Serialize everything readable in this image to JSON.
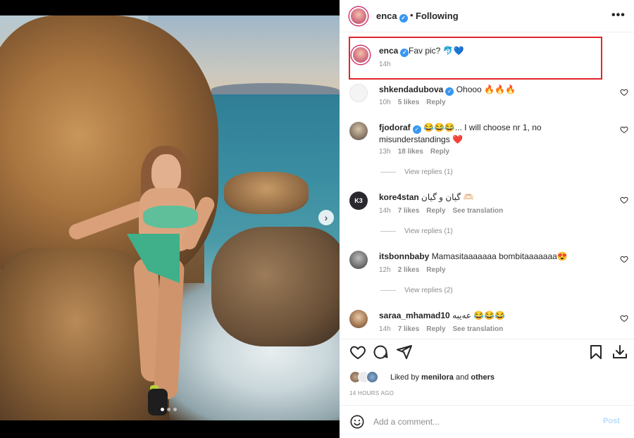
{
  "post": {
    "dots_count": 3,
    "active_dot": 0
  },
  "header": {
    "username": "enca",
    "verified_mark": "✓",
    "separator": "•",
    "follow_label": "Following",
    "more_label": "•••"
  },
  "caption": {
    "username": "enca",
    "text": "Fav pic? 🐬💙",
    "time": "14h"
  },
  "comments": [
    {
      "username": "shkendadubova",
      "verified": true,
      "text": "Ohooo 🔥🔥🔥",
      "time": "10h",
      "likes": "5 likes",
      "reply": "Reply",
      "translation": "",
      "view_replies": ""
    },
    {
      "username": "fjodoraf",
      "verified": true,
      "text": "😂😂😂... I will choose nr 1, no misunderstandings ❤️",
      "time": "13h",
      "likes": "18 likes",
      "reply": "Reply",
      "translation": "",
      "view_replies": "View replies (1)"
    },
    {
      "username": "kore4stan",
      "verified": false,
      "text": "گیان و گیان 🫶🏻",
      "time": "14h",
      "likes": "7 likes",
      "reply": "Reply",
      "translation": "See translation",
      "view_replies": "View replies (1)"
    },
    {
      "username": "itsbonnbaby",
      "verified": false,
      "text": "Mamasitaaaaaaa bombitaaaaaaa😍",
      "time": "12h",
      "likes": "2 likes",
      "reply": "Reply",
      "translation": "",
      "view_replies": "View replies (2)"
    },
    {
      "username": "saraa_mhamad10",
      "verified": false,
      "text": "عەیبە 😂😂😂",
      "time": "14h",
      "likes": "7 likes",
      "reply": "Reply",
      "translation": "See translation",
      "view_replies": ""
    }
  ],
  "kore_avatar_text": "K3",
  "likes": {
    "prefix": "Liked by",
    "user": "menilora",
    "conj": "and",
    "others": "others"
  },
  "post_time": "14 HOURS AGO",
  "composer": {
    "placeholder": "Add a comment...",
    "post_label": "Post"
  },
  "icons": {
    "heart": "heart-icon",
    "comment": "comment-icon",
    "share": "share-icon",
    "save": "bookmark-icon",
    "download": "download-icon",
    "emoji": "emoji-icon"
  },
  "colors": {
    "verified": "#3897f0",
    "highlight_border": "#e0272b",
    "post_button": "#b3dbff"
  }
}
